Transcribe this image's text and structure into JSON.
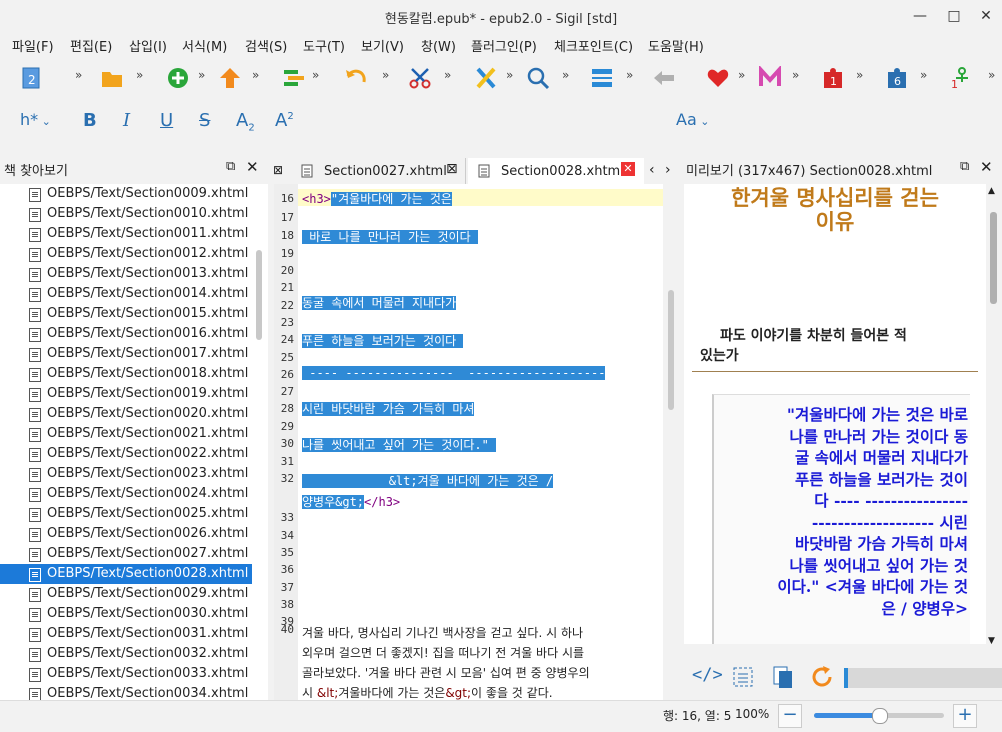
{
  "window": {
    "title": "현동칼럼.epub* - epub2.0 - Sigil [std]"
  },
  "menu": [
    "파일(F)",
    "편집(E)",
    "삽입(I)",
    "서식(M)",
    "검색(S)",
    "도구(T)",
    "보기(V)",
    "창(W)",
    "플러그인(P)",
    "체크포인트(C)",
    "도움말(H)"
  ],
  "toolbar1": {
    "page_badge": "2",
    "plugin_badge_1": "1",
    "plugin_badge_2": "6",
    "plugin_badge_3": "1"
  },
  "toolbar2": {
    "heading_label": "h*",
    "case_label": "Aa",
    "subscript_label": "A",
    "superscript_label": "A"
  },
  "book_browser": {
    "title": "책 찾아보기",
    "files": [
      "OEBPS/Text/Section0009.xhtml",
      "OEBPS/Text/Section0010.xhtml",
      "OEBPS/Text/Section0011.xhtml",
      "OEBPS/Text/Section0012.xhtml",
      "OEBPS/Text/Section0013.xhtml",
      "OEBPS/Text/Section0014.xhtml",
      "OEBPS/Text/Section0015.xhtml",
      "OEBPS/Text/Section0016.xhtml",
      "OEBPS/Text/Section0017.xhtml",
      "OEBPS/Text/Section0018.xhtml",
      "OEBPS/Text/Section0019.xhtml",
      "OEBPS/Text/Section0020.xhtml",
      "OEBPS/Text/Section0021.xhtml",
      "OEBPS/Text/Section0022.xhtml",
      "OEBPS/Text/Section0023.xhtml",
      "OEBPS/Text/Section0024.xhtml",
      "OEBPS/Text/Section0025.xhtml",
      "OEBPS/Text/Section0026.xhtml",
      "OEBPS/Text/Section0027.xhtml",
      "OEBPS/Text/Section0028.xhtml",
      "OEBPS/Text/Section0029.xhtml",
      "OEBPS/Text/Section0030.xhtml",
      "OEBPS/Text/Section0031.xhtml",
      "OEBPS/Text/Section0032.xhtml",
      "OEBPS/Text/Section0033.xhtml",
      "OEBPS/Text/Section0034.xhtml"
    ],
    "selected": "OEBPS/Text/Section0028.xhtml"
  },
  "tabs": [
    {
      "label": "Section0027.xhtml",
      "active": false
    },
    {
      "label": "Section0028.xhtml",
      "active": true
    }
  ],
  "editor": {
    "line_numbers": [
      "16",
      "17",
      "18",
      "19",
      "20",
      "21",
      "22",
      "23",
      "24",
      "25",
      "26",
      "27",
      "28",
      "29",
      "30",
      "31",
      "32",
      "33",
      "34",
      "35",
      "36",
      "37",
      "38",
      "39",
      "40"
    ],
    "open_tag": "<h3>",
    "line16": "\"겨울바다에 가는 것은",
    "line18": " 바로 나를 만나러 가는 것이다 ",
    "line22": "동굴 속에서 머물러 지내다가",
    "line24": "푸른 하늘을 보러가는 것이다 ",
    "line26": " ---- ---------------  -------------------",
    "line28": "시린 바닷바람 가슴 가득히 마셔",
    "line30": "나를 씻어내고 싶어 가는 것이다.\" ",
    "line32a_pre": "            ",
    "line32a_ent": "&lt;",
    "line32a_text": "겨울 바다에 가는 것은 /",
    "line32b_text": "양병우",
    "line32b_ent": "&gt;",
    "close_tag": "</h3>",
    "line40_1": "겨울 바다, 명사십리 기나긴 백사장을 걷고 싶다. 시 하나",
    "line40_2": "외우며 걸으면 더 좋겠지! 집을 떠나기 전 겨울 바다 시를",
    "line40_3": "골라보았다. '겨울 바다 관련 시 모음' 십여 편 중 양병우의",
    "line40_4a": "시 ",
    "line40_4_ent1": "&lt;",
    "line40_4b": "겨울바다에 가는 것은",
    "line40_4_ent2": "&gt;",
    "line40_4c": "이 좋을 것 같다."
  },
  "preview": {
    "title": "미리보기 (317x467) Section0028.xhtml",
    "heading_1": "한겨울 명사십리를 걷는",
    "heading_2": "이유",
    "sub_1": "파도 이야기를 차분히 들어본 적",
    "sub_2": "있는가",
    "quote_lines": [
      "\"겨울바다에 가는 것은 바로",
      "나를 만나러 가는 것이다 동",
      "굴 속에서 머물러 지내다가",
      "푸른 하늘을 보러가는 것이",
      "다 ---- ----------------",
      "------------------- 시린",
      "바닷바람 가슴 가득히 마셔",
      "나를 씻어내고 싶어 가는 것",
      "이다.\" <겨울 바다에 가는 것",
      "은 / 양병우>"
    ],
    "heading_color": "#c07a1a",
    "quote_color": "#1a1ad6"
  },
  "status": {
    "position": "행: 16, 열: 5",
    "zoom": "100%",
    "zoom_fraction": 0.5
  }
}
